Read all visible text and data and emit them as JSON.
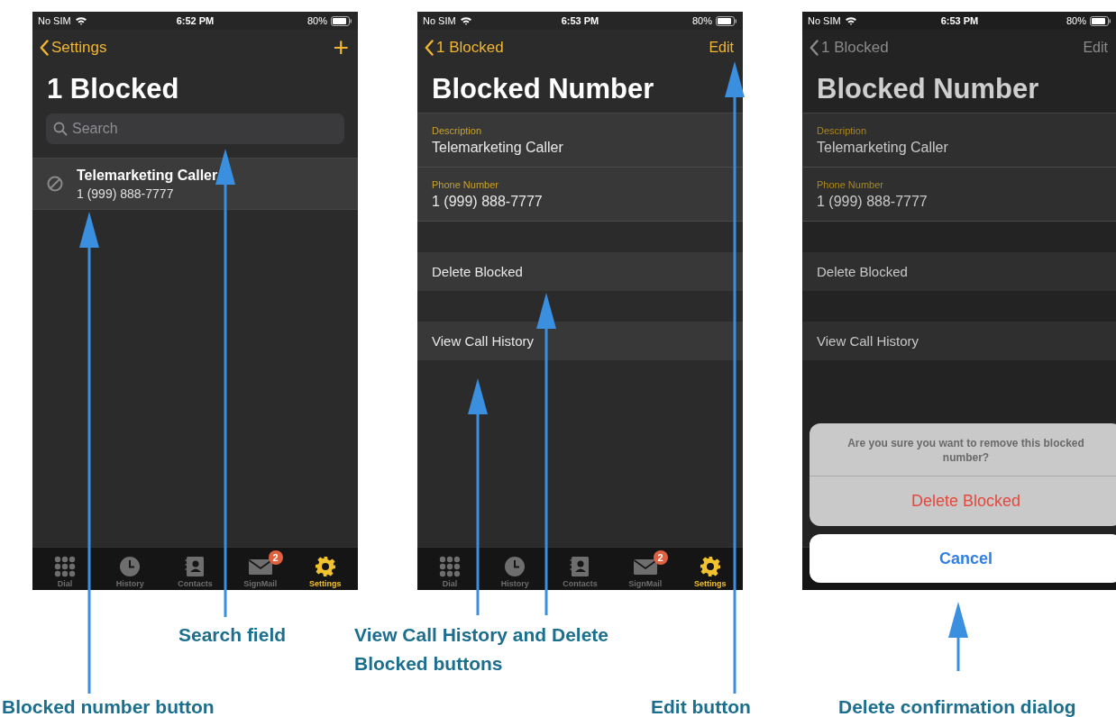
{
  "phones": [
    {
      "dimmed": false,
      "status": {
        "carrier": "No SIM",
        "time": "6:52 PM",
        "battery": "80%"
      },
      "nav": {
        "back": "Settings",
        "action": "+",
        "kind": "icon"
      },
      "title": "1 Blocked",
      "sections": [
        {
          "kind": "search",
          "placeholder": "Search"
        },
        {
          "kind": "blocked_row",
          "name": "Telemarketing Caller",
          "number": "1 (999) 888-7777"
        }
      ],
      "tabs": [
        {
          "kind": "dial",
          "label": "Dial",
          "selected": false
        },
        {
          "kind": "history",
          "label": "History",
          "selected": false
        },
        {
          "kind": "contacts",
          "label": "Contacts",
          "selected": false
        },
        {
          "kind": "mail",
          "label": "SignMail",
          "selected": false,
          "badge": "2"
        },
        {
          "kind": "settings",
          "label": "Settings",
          "selected": true
        }
      ]
    },
    {
      "dimmed": false,
      "status": {
        "carrier": "No SIM",
        "time": "6:53 PM",
        "battery": "80%"
      },
      "nav": {
        "back": "1 Blocked",
        "action": "Edit",
        "kind": "text"
      },
      "title": "Blocked Number",
      "sections": [
        {
          "kind": "fields",
          "fields": [
            {
              "label": "Description",
              "value": "Telemarketing Caller"
            },
            {
              "label": "Phone Number",
              "value": "1 (999) 888-7777"
            }
          ]
        },
        {
          "kind": "action_row",
          "label": "Delete Blocked"
        },
        {
          "kind": "action_row",
          "label": "View Call History"
        }
      ],
      "tabs": [
        {
          "kind": "dial",
          "label": "Dial",
          "selected": false
        },
        {
          "kind": "history",
          "label": "History",
          "selected": false
        },
        {
          "kind": "contacts",
          "label": "Contacts",
          "selected": false
        },
        {
          "kind": "mail",
          "label": "SignMail",
          "selected": false,
          "badge": "2"
        },
        {
          "kind": "settings",
          "label": "Settings",
          "selected": true
        }
      ]
    },
    {
      "dimmed": true,
      "status": {
        "carrier": "No SIM",
        "time": "6:53 PM",
        "battery": "80%"
      },
      "nav": {
        "back": "1 Blocked",
        "action": "Edit",
        "kind": "text"
      },
      "title": "Blocked Number",
      "sections": [
        {
          "kind": "fields",
          "fields": [
            {
              "label": "Description",
              "value": "Telemarketing Caller"
            },
            {
              "label": "Phone Number",
              "value": "1 (999) 888-7777"
            }
          ]
        },
        {
          "kind": "action_row",
          "label": "Delete Blocked"
        },
        {
          "kind": "action_row",
          "label": "View Call History"
        }
      ],
      "dialog": {
        "message": "Are you sure you want to remove this blocked number?",
        "destructive": "Delete Blocked",
        "cancel": "Cancel"
      }
    }
  ],
  "captions": [
    {
      "text": "Search field"
    },
    {
      "text": "View Call History and Delete Blocked buttons"
    },
    {
      "text": "Blocked number button"
    },
    {
      "text": "Edit button"
    },
    {
      "text": "Delete confirmation dialog"
    }
  ]
}
